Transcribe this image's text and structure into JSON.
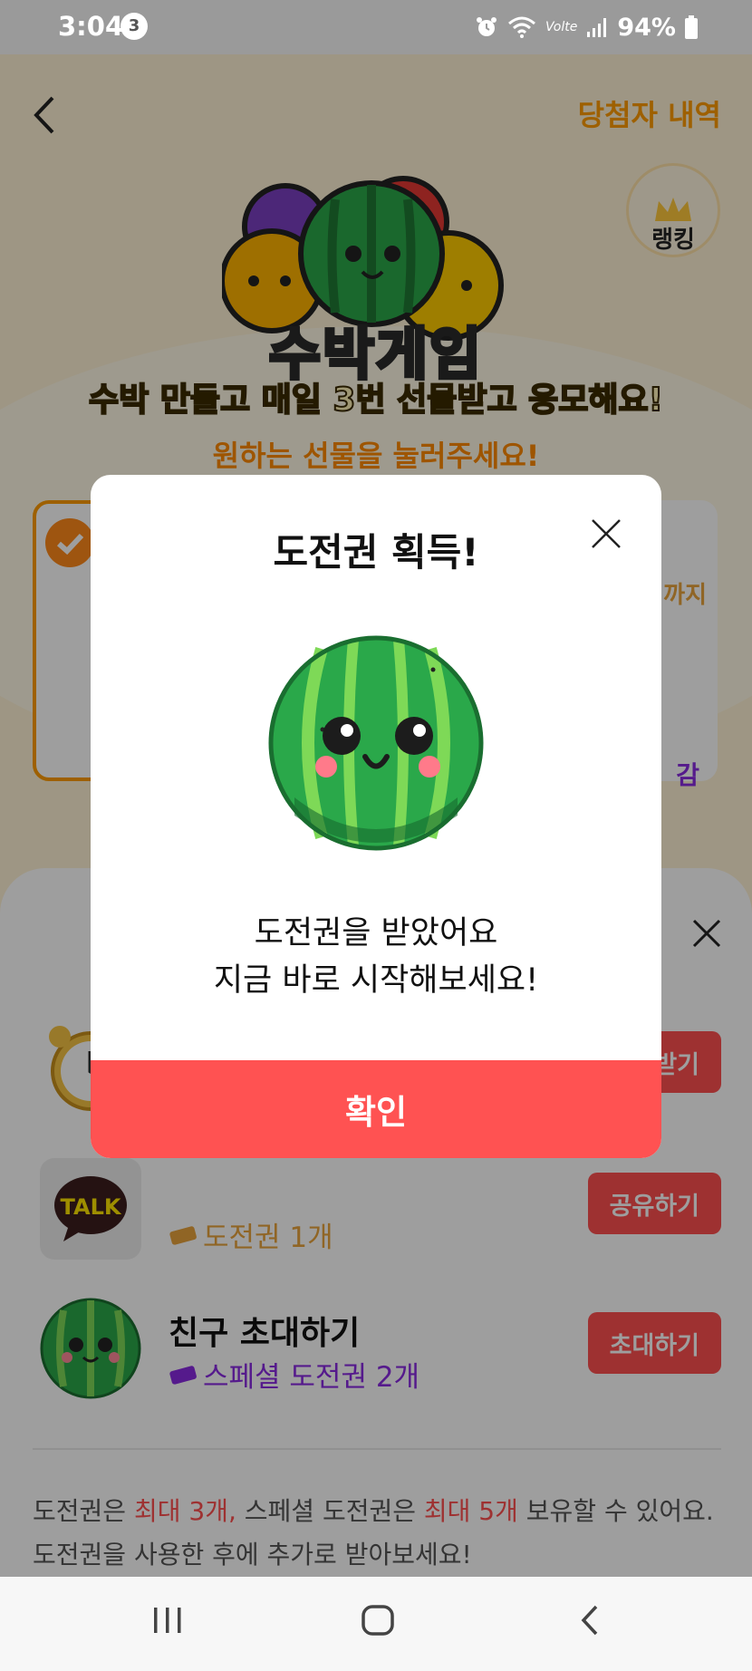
{
  "status_bar": {
    "time": "3:04",
    "notification_count": "3",
    "network_label": "Volte",
    "battery": "94%"
  },
  "header": {
    "winners_link": "당첨자 내역",
    "ranking_label": "랭킹"
  },
  "game": {
    "logo_title": "수박게임",
    "headline": "수박 만들고 매일 3번 선물받고 응모해요!",
    "subline": "원하는 선물을 눌러주세요!",
    "gift_deadline_fragment": "까지",
    "gift_closing_fragment": "감"
  },
  "sheet": {
    "tasks": [
      {
        "title": "",
        "reward": "",
        "button": "받기",
        "icon": "alarm-clock-icon"
      },
      {
        "title": "",
        "reward": "도전권 1개",
        "button": "공유하기",
        "icon": "kakaotalk-icon",
        "thumb_text": "TALK"
      },
      {
        "title": "친구 초대하기",
        "reward": "스페셜 도전권 2개",
        "button": "초대하기",
        "icon": "watermelon-icon"
      }
    ],
    "notice": {
      "p1": "도전권은 ",
      "a1": "최대 3개,",
      "p2": " 스페셜 도전권은 ",
      "a2": "최대 5개",
      "p3": " 보유할 수 있어요.",
      "line2": "도전권을 사용한 후에 추가로 받아보세요!"
    }
  },
  "dialog": {
    "title": "도전권 획득!",
    "message_line1": "도전권을 받았어요",
    "message_line2": "지금 바로 시작해보세요!",
    "confirm_button": "확인",
    "image_icon": "watermelon-icon"
  },
  "colors": {
    "accent_red": "#ff5252",
    "accent_orange": "#ff9c00",
    "special_purple": "#8a2be2",
    "ticket_orange": "#e8a33c",
    "watermelon_green": "#2aa84a"
  }
}
